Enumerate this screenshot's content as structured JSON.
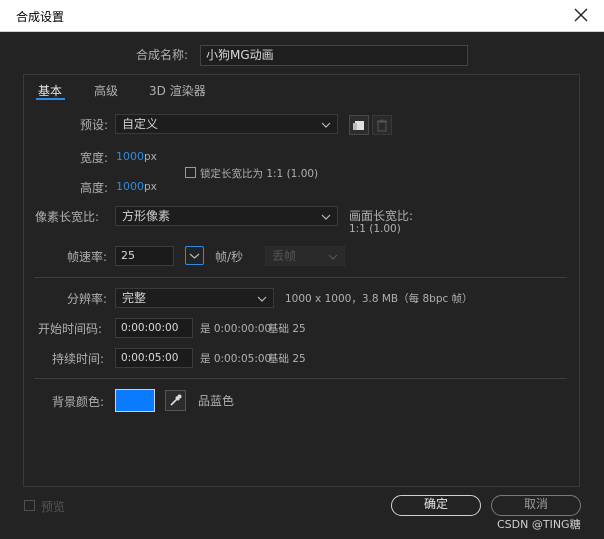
{
  "window": {
    "title": "合成设置"
  },
  "comp_name": {
    "label": "合成名称:",
    "value": "小狗MG动画"
  },
  "tabs": [
    {
      "label": "基本",
      "active": true
    },
    {
      "label": "高级",
      "active": false
    },
    {
      "label": "3D 渲染器",
      "active": false
    }
  ],
  "preset": {
    "label": "预设:",
    "value": "自定义"
  },
  "width": {
    "label": "宽度:",
    "value": "1000",
    "unit": "px"
  },
  "height": {
    "label": "高度:",
    "value": "1000",
    "unit": "px"
  },
  "lock_aspect": {
    "label": "锁定长宽比为 1:1 (1.00)",
    "checked": false
  },
  "pixel_aspect": {
    "label": "像素长宽比:",
    "value": "方形像素"
  },
  "frame_aspect": {
    "label": "画面长宽比:",
    "value": "1:1 (1.00)"
  },
  "frame_rate": {
    "label": "帧速率:",
    "value": "25",
    "unit": "帧/秒",
    "drop_frame": "丢帧"
  },
  "resolution": {
    "label": "分辨率:",
    "value": "完整",
    "info": "1000 x 1000，3.8 MB（每 8bpc 帧）"
  },
  "start_timecode": {
    "label": "开始时间码:",
    "value": "0:00:00:00",
    "equals": "是 0:00:00:00",
    "base": "基础 25"
  },
  "duration": {
    "label": "持续时间:",
    "value": "0:00:05:00",
    "equals": "是 0:00:05:00",
    "base": "基础 25"
  },
  "background": {
    "label": "背景颜色:",
    "color": "#0a7aff",
    "name": "品蓝色"
  },
  "footer": {
    "preview_label": "预览",
    "ok_label": "确定",
    "cancel_label": "取消"
  },
  "watermark": "CSDN @TING糖",
  "colors": {
    "accent": "#2e8ae6",
    "bg": "#232323"
  }
}
